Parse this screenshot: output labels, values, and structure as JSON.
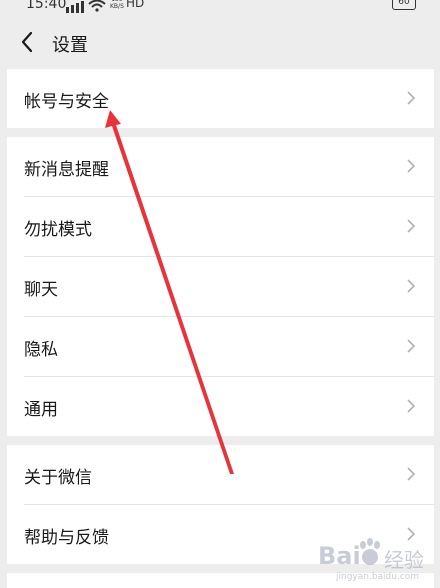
{
  "status_bar": {
    "time": "15:40",
    "network_speed_top": "139",
    "network_speed_unit": "KB/S",
    "hd": "HD",
    "battery": "60"
  },
  "header": {
    "title": "设置"
  },
  "groups": [
    {
      "items": [
        {
          "label": "帐号与安全"
        }
      ]
    },
    {
      "items": [
        {
          "label": "新消息提醒"
        },
        {
          "label": "勿扰模式"
        },
        {
          "label": "聊天"
        },
        {
          "label": "隐私"
        },
        {
          "label": "通用"
        }
      ]
    },
    {
      "items": [
        {
          "label": "关于微信"
        },
        {
          "label": "帮助与反馈"
        }
      ]
    }
  ],
  "annotation": {
    "color": "#e8333a"
  },
  "watermark": {
    "brand": "Bai",
    "brand_suffix": "经验",
    "url": "jingyan.baidu.com"
  },
  "colors": {
    "background": "#ededed",
    "card": "#ffffff",
    "divider": "#e5e5e5",
    "text": "#191919",
    "chevron": "#b2b2b2"
  }
}
